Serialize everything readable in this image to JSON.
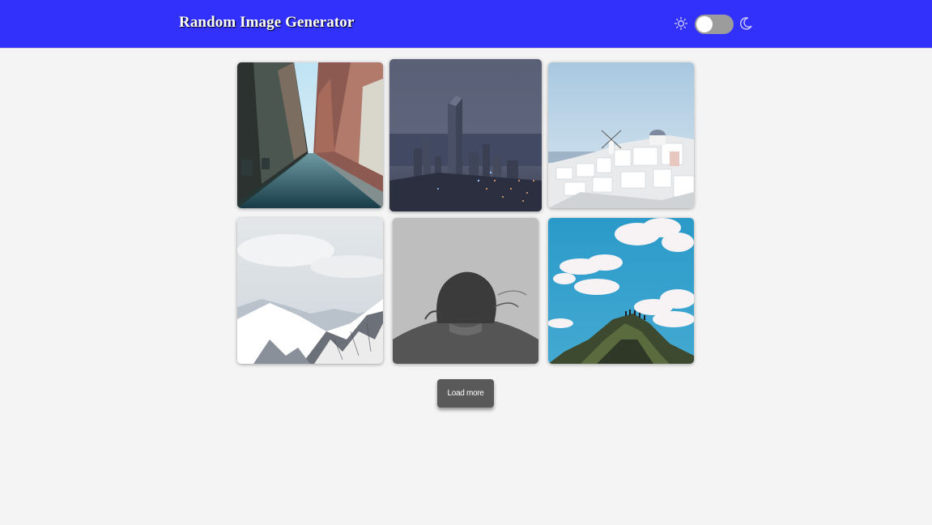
{
  "header": {
    "title": "Random Image Generator",
    "background_color": "#3131fb"
  },
  "theme_toggle": {
    "light_icon": "sun-icon",
    "dark_icon": "moon-icon",
    "state": "light"
  },
  "gallery": {
    "images": [
      {
        "subject": "city-street-icon"
      },
      {
        "subject": "city-skyline-night-icon"
      },
      {
        "subject": "white-village-windmill-icon"
      },
      {
        "subject": "snowy-mountains-icon"
      },
      {
        "subject": "person-back-grayscale-icon"
      },
      {
        "subject": "rock-peak-clouds-icon"
      }
    ]
  },
  "actions": {
    "load_more_label": "Load more"
  }
}
